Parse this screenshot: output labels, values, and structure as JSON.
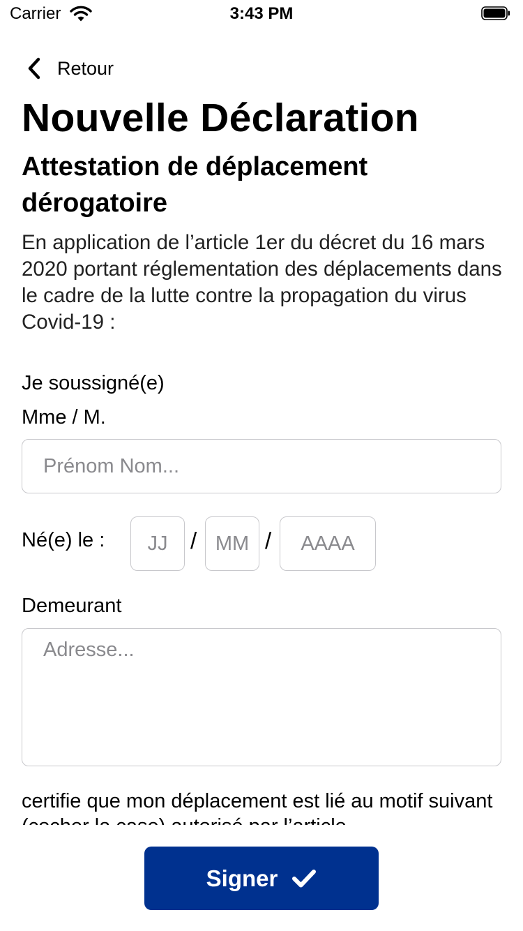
{
  "status_bar": {
    "carrier": "Carrier",
    "time": "3:43 PM",
    "icons": [
      "wifi-icon",
      "battery-icon"
    ]
  },
  "nav": {
    "back_label": "Retour",
    "back_icon": "chevron-left-icon"
  },
  "page": {
    "title": "Nouvelle Déclaration",
    "subtitle": "Attestation de déplacement dérogatoire",
    "intro": "En application de l’article 1er du décret du 16 mars 2020 portant réglementation des déplacements dans le cadre de la lutte contre la propagation du virus Covid-19 :"
  },
  "form": {
    "soussigne_label": "Je soussigné(e)",
    "civility_label": "Mme / M.",
    "name_value": "",
    "name_placeholder": "Prénom Nom...",
    "birth_label": "Né(e) le :",
    "birth_day_value": "",
    "birth_day_placeholder": "JJ",
    "birth_month_value": "",
    "birth_month_placeholder": "MM",
    "birth_year_value": "",
    "birth_year_placeholder": "AAAA",
    "date_separator": "/",
    "address_label": "Demeurant",
    "address_value": "",
    "address_placeholder": "Adresse...",
    "certifie_text": "certifie que mon déplacement est lié au motif suivant (cocher la case) autorisé par l’article"
  },
  "actions": {
    "sign_label": "Signer",
    "sign_icon": "checkmark-icon"
  },
  "colors": {
    "primary": "#00318f",
    "input_border": "#c8c8cc",
    "placeholder": "#8a8a8e",
    "background": "#ffffff"
  }
}
